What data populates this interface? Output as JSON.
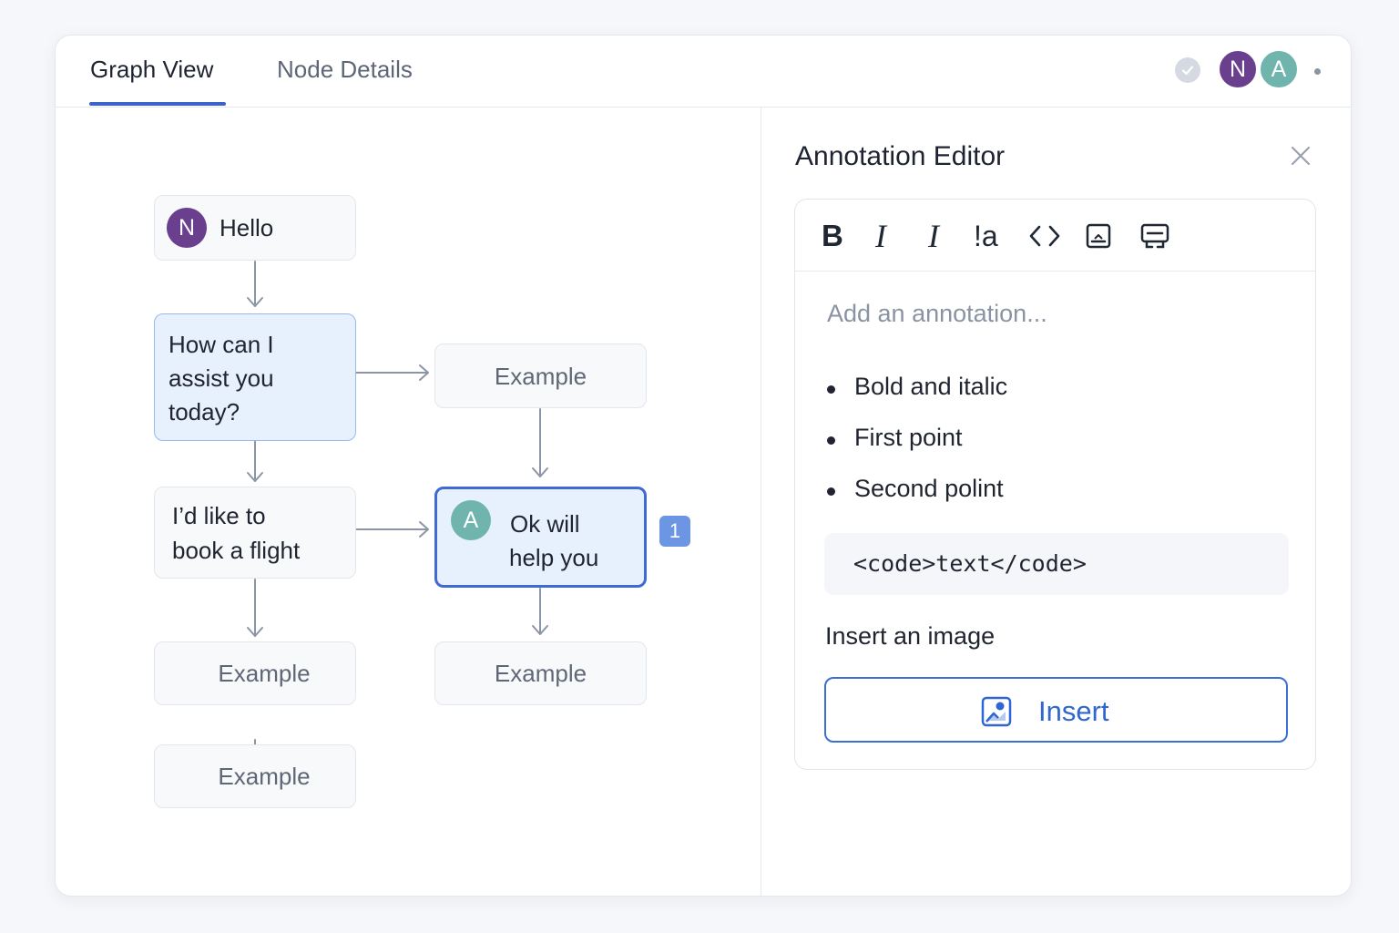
{
  "tabs": [
    {
      "label": "Graph View",
      "active": true
    },
    {
      "label": "Node Details",
      "active": false
    }
  ],
  "header": {
    "avatars": [
      {
        "initial": "N",
        "color": "#6a3f8e"
      },
      {
        "initial": "A",
        "color": "#6fb4ad"
      }
    ],
    "status_icon": "check-circle-icon"
  },
  "graph": {
    "nodes": {
      "hello": {
        "avatar": "N",
        "text": "Hello"
      },
      "assist": {
        "line1": "How can I",
        "line2": "assist you",
        "line3": "today?"
      },
      "example_top": {
        "text": "Example"
      },
      "book": {
        "line1": "I’d like to",
        "line2": "book a flight"
      },
      "ok": {
        "avatar": "A",
        "line1": "Ok will",
        "line2": "help you"
      },
      "example_left1": {
        "text": "Example"
      },
      "example_right": {
        "text": "Example"
      },
      "example_left2": {
        "text": "Example"
      }
    },
    "comment_count": "1"
  },
  "editor": {
    "title": "Annotation Editor",
    "toolbar": {
      "bold": "B",
      "italic": "I",
      "italic_alt": "I",
      "strike": "!a"
    },
    "placeholder": "Add an annotation...",
    "bullets": [
      "Bold and italic",
      "First point",
      "Second polint"
    ],
    "code": "<code>text</code>",
    "image_label": "Insert an image",
    "insert_button": "Insert"
  },
  "colors": {
    "accent": "#3b63c9",
    "selected_border": "#3e6ad1",
    "badge": "#6c96e3"
  }
}
